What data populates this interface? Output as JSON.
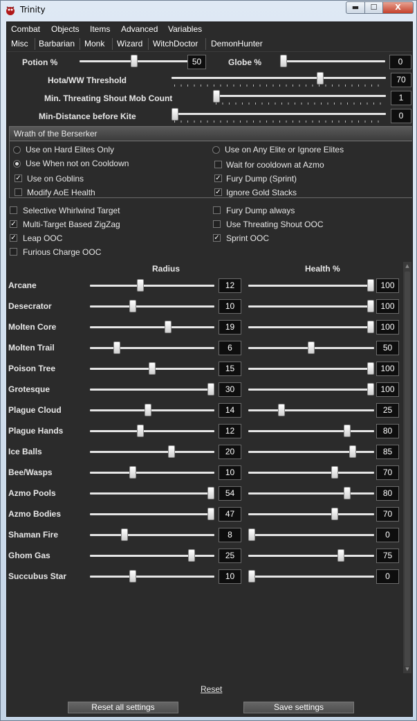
{
  "window": {
    "title": "Trinity",
    "min_glyph": "▬",
    "max_glyph": "☐",
    "close_glyph": "X"
  },
  "menu": [
    "Combat",
    "Objects",
    "Items",
    "Advanced",
    "Variables"
  ],
  "tabs": [
    "Misc",
    "Barbarian",
    "Monk",
    "Wizard",
    "WitchDoctor",
    "DemonHunter"
  ],
  "top_settings": {
    "potion": {
      "label": "Potion %",
      "value": "50",
      "level": 0.5
    },
    "globe": {
      "label": "Globe %",
      "value": "0",
      "level": 0
    },
    "hota": {
      "label": "Hota/WW Threshold",
      "value": "70",
      "level": 0.7
    },
    "threating": {
      "label": "Min. Threating Shout Mob Count",
      "value": "1",
      "level": 0.0
    },
    "kite": {
      "label": "Min-Distance before Kite",
      "value": "0",
      "level": 0
    }
  },
  "wrath": {
    "header": "Wrath of the Berserker",
    "opt_hard_elites": "Use on Hard Elites Only",
    "opt_any_elite": "Use on Any Elite or Ignore Elites",
    "opt_not_cooldown": "Use When not on Cooldown",
    "wait_cooldown": "Wait for cooldown at Azmo",
    "use_goblins": "Use on Goblins",
    "fury_dump_sprint": "Fury Dump (Sprint)",
    "modify_aoe": "Modify AoE Health",
    "ignore_gold": "Ignore Gold Stacks"
  },
  "options": {
    "selective_ww": "Selective Whirlwind Target",
    "fury_dump_always": "Fury Dump always",
    "zigzag": "Multi-Target Based ZigZag",
    "threating_ooc": "Use Threating Shout OOC",
    "leap_ooc": "Leap OOC",
    "sprint_ooc": "Sprint OOC",
    "furious_charge": "Furious Charge OOC"
  },
  "aoe": {
    "radius_header": "Radius",
    "health_header": "Health %",
    "rows": [
      {
        "name": "Arcane",
        "radius": 12,
        "health": 100
      },
      {
        "name": "Desecrator",
        "radius": 10,
        "health": 100
      },
      {
        "name": "Molten Core",
        "radius": 19,
        "health": 100
      },
      {
        "name": "Molten Trail",
        "radius": 6,
        "health": 50
      },
      {
        "name": "Poison Tree",
        "radius": 15,
        "health": 100
      },
      {
        "name": "Grotesque",
        "radius": 30,
        "health": 100
      },
      {
        "name": "Plague Cloud",
        "radius": 14,
        "health": 25
      },
      {
        "name": "Plague Hands",
        "radius": 12,
        "health": 80
      },
      {
        "name": "Ice Balls",
        "radius": 20,
        "health": 85
      },
      {
        "name": "Bee/Wasps",
        "radius": 10,
        "health": 70
      },
      {
        "name": "Azmo Pools",
        "radius": 54,
        "health": 80
      },
      {
        "name": "Azmo Bodies",
        "radius": 47,
        "health": 70
      },
      {
        "name": "Shaman Fire",
        "radius": 8,
        "health": 0
      },
      {
        "name": "Ghom Gas",
        "radius": 25,
        "health": 75
      },
      {
        "name": "Succubus Star",
        "radius": 10,
        "health": 0
      }
    ]
  },
  "footer": {
    "reset": "Reset",
    "reset_all": "Reset all settings",
    "save": "Save settings"
  }
}
